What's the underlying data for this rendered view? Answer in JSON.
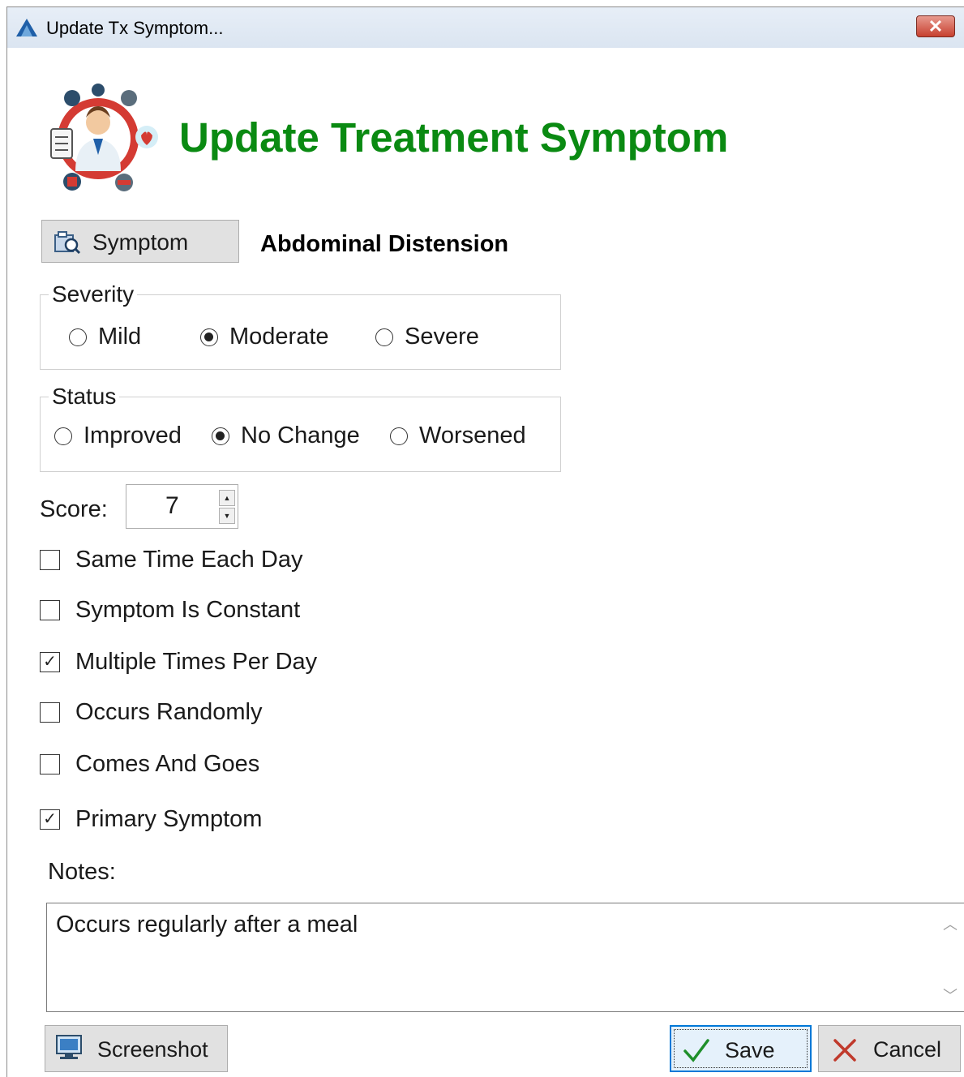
{
  "window": {
    "title": "Update Tx Symptom...",
    "close_glyph": "✕"
  },
  "header": {
    "title": "Update Treatment Symptom",
    "logo_icon": "doctor-medical-icon",
    "title_color": "#0a8a12"
  },
  "symptom": {
    "button_label": "Symptom",
    "value": "Abdominal Distension"
  },
  "severity": {
    "legend": "Severity",
    "options": [
      "Mild",
      "Moderate",
      "Severe"
    ],
    "selected": "Moderate"
  },
  "status": {
    "legend": "Status",
    "options": [
      "Improved",
      "No Change",
      "Worsened"
    ],
    "selected": "No Change"
  },
  "score": {
    "label": "Score:",
    "value": "7"
  },
  "checkboxes": [
    {
      "label": "Same Time Each Day",
      "checked": false
    },
    {
      "label": "Symptom Is Constant",
      "checked": false
    },
    {
      "label": "Multiple Times Per Day",
      "checked": true
    },
    {
      "label": "Occurs Randomly",
      "checked": false
    },
    {
      "label": "Comes And Goes",
      "checked": false
    },
    {
      "label": "Primary Symptom",
      "checked": true
    }
  ],
  "notes": {
    "label": "Notes:",
    "value": "Occurs regularly after a meal"
  },
  "buttons": {
    "screenshot": "Screenshot",
    "save": "Save",
    "cancel": "Cancel"
  },
  "colors": {
    "accent": "#0078d7",
    "save_check": "#1e8f2a",
    "cancel_x": "#c0392b"
  }
}
